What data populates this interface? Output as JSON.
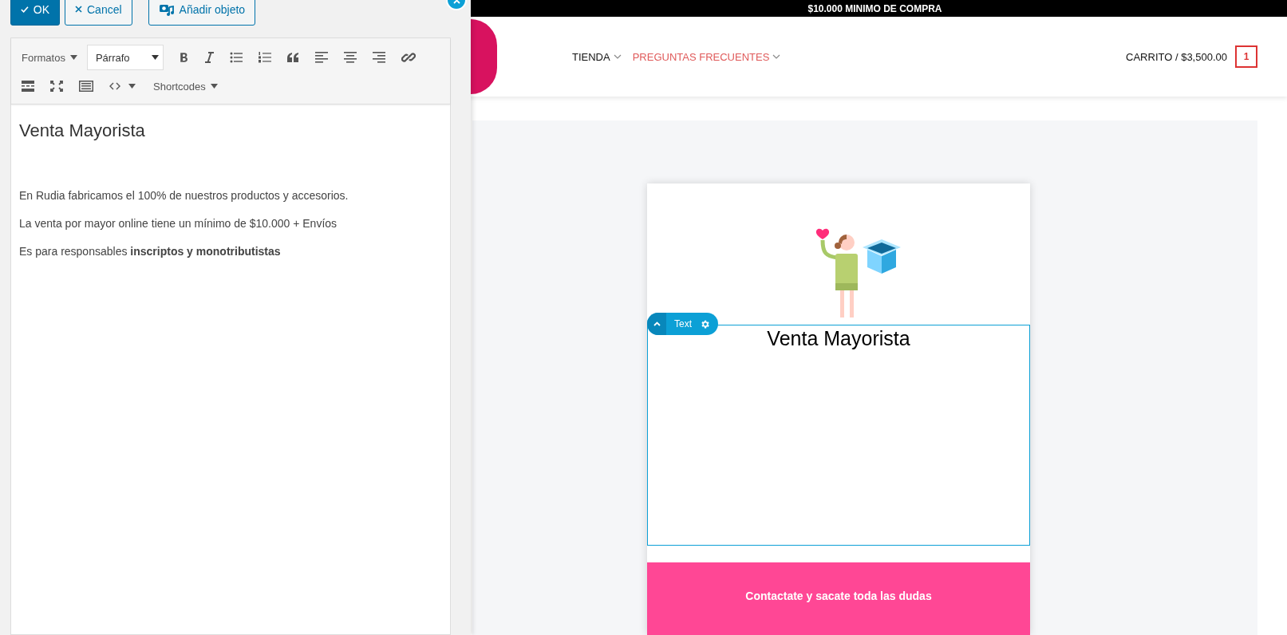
{
  "editor_panel": {
    "buttons": [
      {
        "label": "OK",
        "kind": "primary"
      },
      {
        "label": "Cancel",
        "kind": "cancel"
      },
      {
        "label": "Añadir objeto",
        "kind": "media"
      }
    ],
    "toolbar": {
      "formats": "Formatos",
      "paragraph_select": {
        "value": "Párrafo"
      },
      "shortcodes": "Shortcodes"
    },
    "content": {
      "heading": "Venta Mayorista",
      "paragraphs": [
        "En Rudia fabricamos el 100% de nuestros productos y accesorios.",
        "La venta por mayor online tiene un mínimo de $10.000 + Envíos",
        "Es para responsables **inscriptos y monotributistas**"
      ]
    }
  },
  "site": {
    "announcement": "$10.000 MINIMO DE COMPRA",
    "nav": [
      {
        "label": "TIENDA",
        "selected": false
      },
      {
        "label": "PREGUNTAS FRECUENTES",
        "selected": true
      }
    ],
    "cart": {
      "label": "CARRITO / $3,500.00",
      "count": "1"
    },
    "widget_toolbar": {
      "label": "Text"
    },
    "card_heading": "Venta Mayorista",
    "banner": "Contactate y sacate toda las dudas"
  }
}
